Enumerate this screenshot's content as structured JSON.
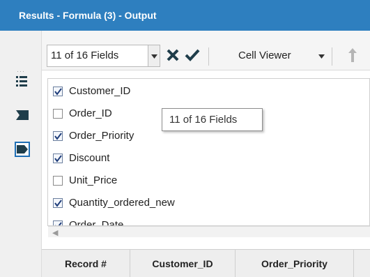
{
  "window": {
    "title": "Results - Formula (3) - Output"
  },
  "toolbar": {
    "field_selector_value": "11 of 16 Fields",
    "cell_viewer_label": "Cell Viewer"
  },
  "fields": [
    {
      "name": "Customer_ID",
      "checked": true
    },
    {
      "name": "Order_ID",
      "checked": false
    },
    {
      "name": "Order_Priority",
      "checked": true
    },
    {
      "name": "Discount",
      "checked": true
    },
    {
      "name": "Unit_Price",
      "checked": false
    },
    {
      "name": "Quantity_ordered_new",
      "checked": true
    },
    {
      "name": "Order_Date",
      "checked": true
    }
  ],
  "tooltip": {
    "text": "11 of 16 Fields"
  },
  "grid": {
    "columns": [
      "Record #",
      "Customer_ID",
      "Order_Priority"
    ]
  },
  "colors": {
    "title_bar": "#2e7fbf",
    "accent_blue": "#1f6fb5",
    "icon_dark": "#1f3d4a"
  },
  "icons": {
    "left_strip": [
      "list-icon",
      "tag-icon",
      "tag-selected-icon"
    ],
    "toolbar": [
      "chevron-down-icon",
      "deselect-x-icon",
      "apply-check-icon",
      "chevron-down-icon",
      "sort-up-arrow-icon"
    ]
  }
}
